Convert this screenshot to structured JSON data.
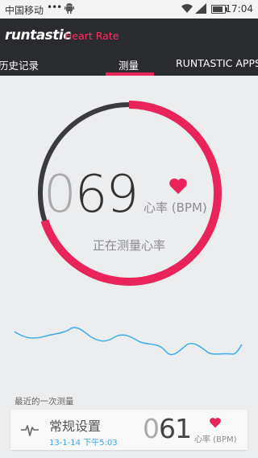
{
  "status_bar": {
    "carrier": "中国移动",
    "dots": "•••",
    "time": "17:04"
  },
  "app": {
    "brand": "runtastic",
    "subtitle": "Heart Rate"
  },
  "tabs": [
    {
      "label": "历史记录"
    },
    {
      "label": "测量",
      "active": true
    },
    {
      "label": "RUNTASTIC APPS"
    }
  ],
  "measurement": {
    "bpm_lead": "0",
    "bpm_digits": "69",
    "unit": "心率 (BPM)",
    "status_text": "正在测量心率",
    "progress": 0.7
  },
  "recent": {
    "label": "最近的一次测量",
    "title": "常规设置",
    "date": "13-1-14 下午5:03",
    "bpm_lead": "0",
    "bpm_digits": "61",
    "unit": "心率 (BPM)"
  },
  "colors": {
    "accent": "#e8245a",
    "dark_arc": "#3a3b3f",
    "wave": "#45aee8",
    "date": "#3aa7e0"
  },
  "icons": [
    "android-icon",
    "wifi-icon",
    "signal-icon",
    "battery-icon",
    "heart-icon",
    "pulse-icon"
  ]
}
